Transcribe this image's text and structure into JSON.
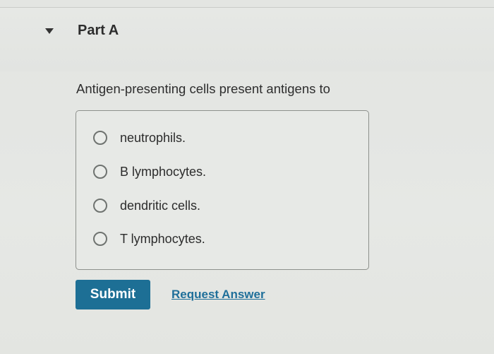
{
  "part": {
    "title": "Part A",
    "caret_icon": "caret-down-icon"
  },
  "question": {
    "text": "Antigen-presenting cells present antigens to"
  },
  "choices": [
    {
      "label": "neutrophils.",
      "selected": false
    },
    {
      "label": "B lymphocytes.",
      "selected": false
    },
    {
      "label": "dendritic cells.",
      "selected": false
    },
    {
      "label": "T lymphocytes.",
      "selected": false
    }
  ],
  "actions": {
    "submit_label": "Submit",
    "request_answer_label": "Request Answer"
  },
  "colors": {
    "submit_bg": "#1d6f95",
    "link": "#1f6f9a",
    "background": "#e4e6e3"
  }
}
